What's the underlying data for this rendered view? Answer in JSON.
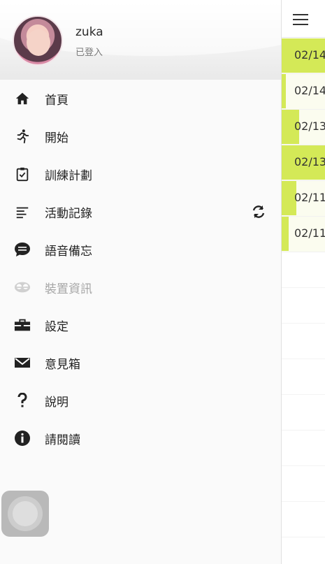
{
  "profile": {
    "username": "zuka",
    "status": "已登入"
  },
  "menu": [
    {
      "label": "首頁",
      "icon": "home-icon"
    },
    {
      "label": "開始",
      "icon": "runner-icon"
    },
    {
      "label": "訓練計劃",
      "icon": "clipboard-check-icon"
    },
    {
      "label": "活動記錄",
      "icon": "list-icon",
      "extra_icon": "sync-icon"
    },
    {
      "label": "語音備忘",
      "icon": "chat-bubble-icon"
    },
    {
      "label": "裝置資訊",
      "icon": "device-icon",
      "disabled": true
    },
    {
      "label": "設定",
      "icon": "toolbox-icon"
    },
    {
      "label": "意見箱",
      "icon": "envelope-icon"
    },
    {
      "label": "說明",
      "icon": "question-icon"
    },
    {
      "label": "請閱讀",
      "icon": "info-icon"
    }
  ],
  "records": [
    {
      "date": "02/14",
      "fill": 1.0
    },
    {
      "date": "02/14",
      "fill": 0.1
    },
    {
      "date": "02/13",
      "fill": 0.4
    },
    {
      "date": "02/13",
      "fill": 1.0
    },
    {
      "date": "02/11",
      "fill": 0.33
    },
    {
      "date": "02/11",
      "fill": 0.16
    }
  ],
  "colors": {
    "accent": "#d4e957",
    "row_bg": "#fbfcef"
  }
}
